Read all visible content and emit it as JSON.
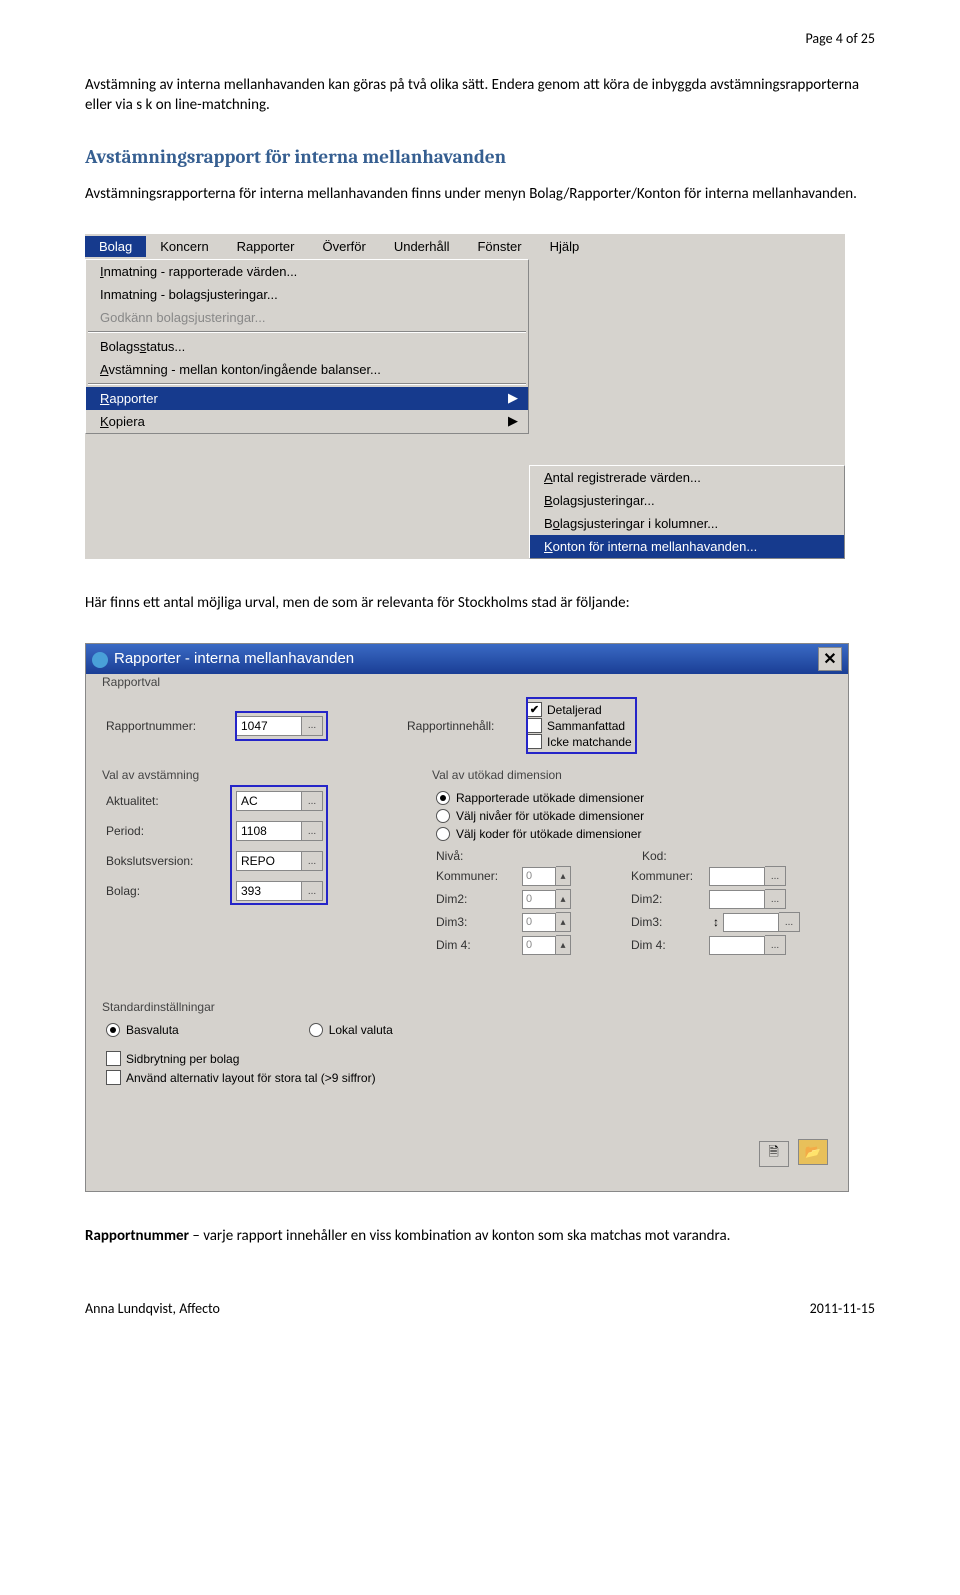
{
  "page": {
    "header": "Page 4 of 25",
    "para1": "Avstämning av interna mellanhavanden kan göras på två olika sätt. Endera genom att köra de inbyggda avstämningsrapporterna eller via s k on line-matchning.",
    "heading1": "Avstämningsrapport för interna mellanhavanden",
    "para2": "Avstämningsrapporterna för interna mellanhavanden finns under menyn Bolag/Rapporter/Konton för interna mellanhavanden.",
    "para3": "Här finns ett antal möjliga urval, men de som är relevanta för Stockholms stad är följande:",
    "para4a": "Rapportnummer",
    "para4b": " – varje rapport innehåller en viss kombination av konton som ska matchas mot varandra.",
    "footer_left": "Anna Lundqvist, Affecto",
    "footer_right": "2011-11-15"
  },
  "menu": {
    "items": [
      "Bolag",
      "Koncern",
      "Rapporter",
      "Överför",
      "Underhåll",
      "Fönster",
      "Hjälp"
    ],
    "dropdown": {
      "i0": "Inmatning - rapporterade värden...",
      "i1": "Inmatning - bolagsjusteringar...",
      "i2": "Godkänn bolagsjusteringar...",
      "i3_pre": "Bolags",
      "i3_u": "s",
      "i3_post": "tatus...",
      "i4": "Avstämning - mellan konton/ingående balanser...",
      "i5": "Rapporter",
      "i6": "Kopiera"
    },
    "submenu": {
      "s0_u": "A",
      "s0": "ntal registrerade värden...",
      "s1_u": "B",
      "s1": "olagsjusteringar...",
      "s2_pre": "B",
      "s2_u": "o",
      "s2_post": "lagsjusteringar i kolumner...",
      "s3_u": "K",
      "s3": "onton för interna mellanhavanden..."
    }
  },
  "dialog": {
    "title": "Rapporter - interna mellanhavanden",
    "groups": {
      "rapportval": "Rapportval",
      "valav": "Val av avstämning",
      "valut": "Val av utökad dimension",
      "std": "Standardinställningar"
    },
    "labels": {
      "rapportnummer": "Rapportnummer:",
      "rapportinnehall": "Rapportinnehåll:",
      "detaljerad": "Detaljerad",
      "sammanfattad": "Sammanfattad",
      "icke": "Icke matchande",
      "aktualitet": "Aktualitet:",
      "period": "Period:",
      "bokslutsversion": "Bokslutsversion:",
      "bolag": "Bolag:",
      "r1": "Rapporterade utökade dimensioner",
      "r2": "Välj nivåer för utökade dimensioner",
      "r3": "Välj koder för utökade dimensioner",
      "niva": "Nivå:",
      "kod": "Kod:",
      "kommuner": "Kommuner:",
      "dim2": "Dim2:",
      "dim3": "Dim3:",
      "dim4": "Dim 4:",
      "basvaluta": "Basvaluta",
      "lokalvaluta": "Lokal valuta",
      "sidbrytning": "Sidbrytning per bolag",
      "altlayout": "Använd alternativ layout för stora tal (>9 siffror)"
    },
    "values": {
      "rapportnummer": "1047",
      "aktualitet": "AC",
      "period": "1108",
      "bokslutsversion": "REPO",
      "bolag": "393",
      "nivaval": "0"
    }
  }
}
